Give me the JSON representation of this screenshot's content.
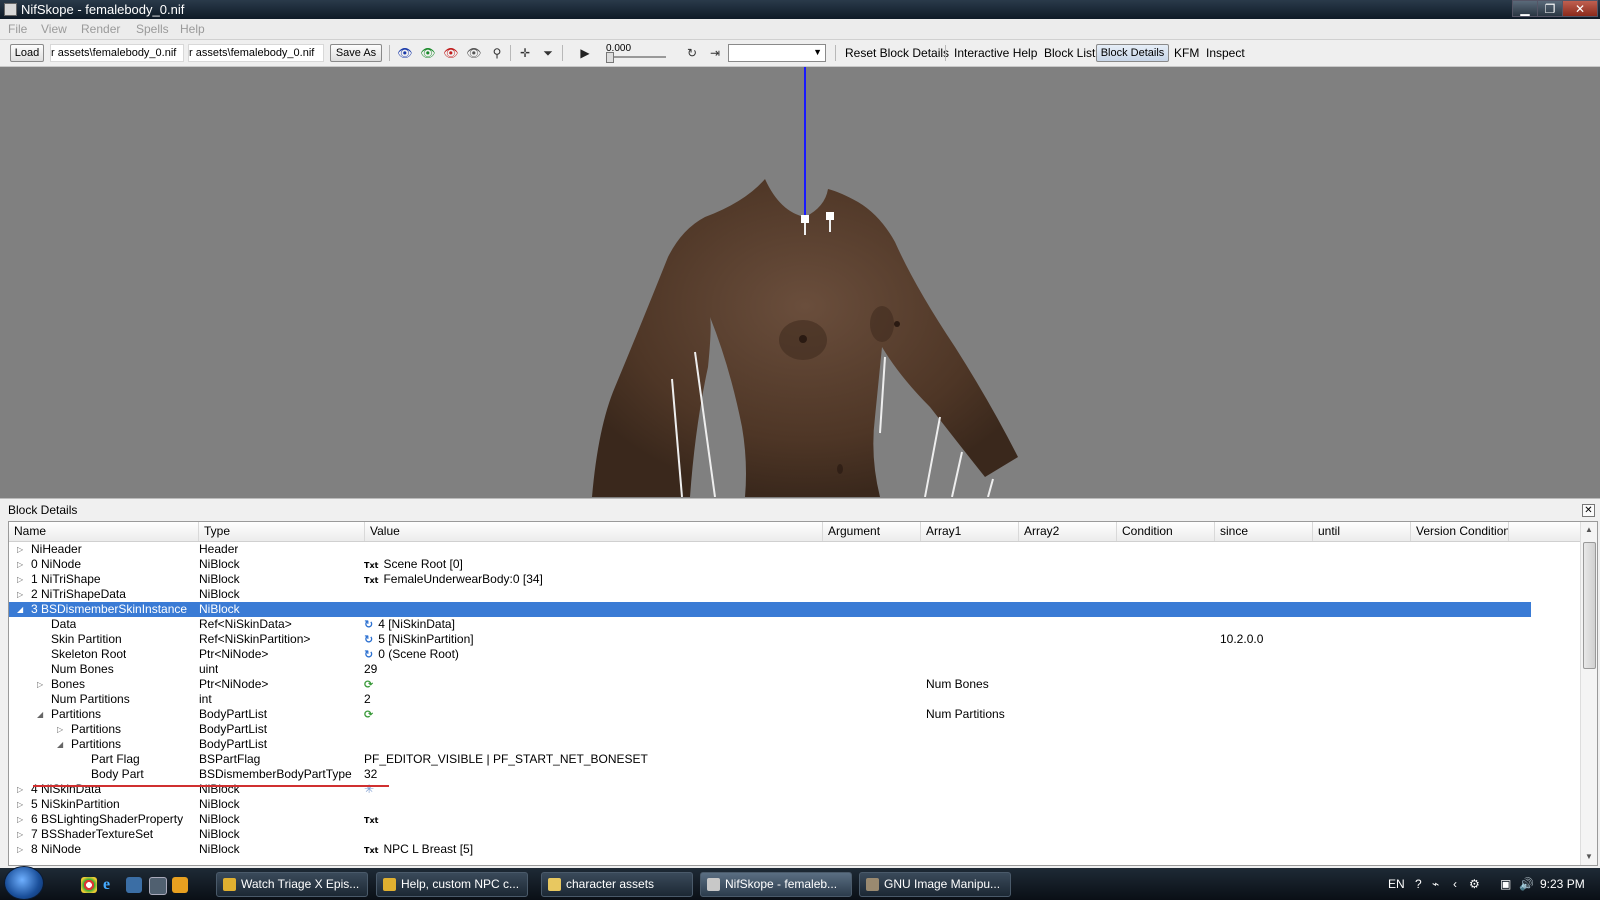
{
  "window": {
    "title": "NifSkope - femalebody_0.nif",
    "min": "▁",
    "max": "❐",
    "close": "✕"
  },
  "menu": [
    "File",
    "View",
    "Render",
    "Spells",
    "Help"
  ],
  "toolbar": {
    "load": "Load",
    "path1": "r assets\\femalebody_0.nif",
    "path2": "r assets\\femalebody_0.nif",
    "save_as": "Save As",
    "time": "0.000",
    "anim_select": "",
    "links": [
      "Reset Block Details",
      "Interactive Help",
      "Block List",
      "Block Details",
      "KFM",
      "Inspect"
    ]
  },
  "panel": {
    "title": "Block Details",
    "columns": [
      "Name",
      "Type",
      "Value",
      "Argument",
      "Array1",
      "Array2",
      "Condition",
      "since",
      "until",
      "Version Condition"
    ],
    "rows": [
      {
        "name": "NiHeader",
        "type": "Header",
        "value": "",
        "icon": "",
        "array1": "",
        "since": "",
        "level": 0,
        "exp": "closed",
        "selected": false
      },
      {
        "name": "0 NiNode",
        "type": "NiBlock",
        "value": "Scene Root [0]",
        "icon": "Txt",
        "array1": "",
        "since": "",
        "level": 0,
        "exp": "closed",
        "selected": false
      },
      {
        "name": "1 NiTriShape",
        "type": "NiBlock",
        "value": "FemaleUnderwearBody:0 [34]",
        "icon": "Txt",
        "array1": "",
        "since": "",
        "level": 0,
        "exp": "closed",
        "selected": false
      },
      {
        "name": "2 NiTriShapeData",
        "type": "NiBlock",
        "value": "",
        "icon": "",
        "array1": "",
        "since": "",
        "level": 0,
        "exp": "closed",
        "selected": false
      },
      {
        "name": "3 BSDismemberSkinInstance",
        "type": "NiBlock",
        "value": "",
        "icon": "",
        "array1": "",
        "since": "",
        "level": 0,
        "exp": "open",
        "selected": true
      },
      {
        "name": "Data",
        "type": "Ref<NiSkinData>",
        "value": "4 [NiSkinData]",
        "icon": "ref",
        "array1": "",
        "since": "",
        "level": 1,
        "exp": "",
        "selected": false
      },
      {
        "name": "Skin Partition",
        "type": "Ref<NiSkinPartition>",
        "value": "5 [NiSkinPartition]",
        "icon": "ref",
        "array1": "",
        "since": "10.2.0.0",
        "level": 1,
        "exp": "",
        "selected": false
      },
      {
        "name": "Skeleton Root",
        "type": "Ptr<NiNode>",
        "value": "0 (Scene Root)",
        "icon": "ref",
        "array1": "",
        "since": "",
        "level": 1,
        "exp": "",
        "selected": false
      },
      {
        "name": "Num Bones",
        "type": "uint",
        "value": "29",
        "icon": "",
        "array1": "",
        "since": "",
        "level": 1,
        "exp": "",
        "selected": false
      },
      {
        "name": "Bones",
        "type": "Ptr<NiNode>",
        "value": "",
        "icon": "arr",
        "array1": "Num Bones",
        "since": "",
        "level": 1,
        "exp": "closed",
        "selected": false
      },
      {
        "name": "Num Partitions",
        "type": "int",
        "value": "2",
        "icon": "",
        "array1": "",
        "since": "",
        "level": 1,
        "exp": "",
        "selected": false
      },
      {
        "name": "Partitions",
        "type": "BodyPartList",
        "value": "",
        "icon": "arr",
        "array1": "Num Partitions",
        "since": "",
        "level": 1,
        "exp": "open",
        "selected": false
      },
      {
        "name": "Partitions",
        "type": "BodyPartList",
        "value": "",
        "icon": "",
        "array1": "",
        "since": "",
        "level": 2,
        "exp": "closed",
        "selected": false
      },
      {
        "name": "Partitions",
        "type": "BodyPartList",
        "value": "",
        "icon": "",
        "array1": "",
        "since": "",
        "level": 2,
        "exp": "open",
        "selected": false
      },
      {
        "name": "Part Flag",
        "type": "BSPartFlag",
        "value": "PF_EDITOR_VISIBLE | PF_START_NET_BONESET",
        "icon": "",
        "array1": "",
        "since": "",
        "level": 3,
        "exp": "",
        "selected": false
      },
      {
        "name": "Body Part",
        "type": "BSDismemberBodyPartType",
        "value": "32",
        "icon": "",
        "array1": "",
        "since": "",
        "level": 3,
        "exp": "",
        "selected": false
      },
      {
        "name": "4 NiSkinData",
        "type": "NiBlock",
        "value": "",
        "icon": "star",
        "array1": "",
        "since": "",
        "level": 0,
        "exp": "closed",
        "selected": false
      },
      {
        "name": "5 NiSkinPartition",
        "type": "NiBlock",
        "value": "",
        "icon": "",
        "array1": "",
        "since": "",
        "level": 0,
        "exp": "closed",
        "selected": false
      },
      {
        "name": "6 BSLightingShaderProperty",
        "type": "NiBlock",
        "value": "",
        "icon": "Txt",
        "array1": "",
        "since": "",
        "level": 0,
        "exp": "closed",
        "selected": false
      },
      {
        "name": "7 BSShaderTextureSet",
        "type": "NiBlock",
        "value": "",
        "icon": "",
        "array1": "",
        "since": "",
        "level": 0,
        "exp": "closed",
        "selected": false
      },
      {
        "name": "8 NiNode",
        "type": "NiBlock",
        "value": "NPC L Breast [5]",
        "icon": "Txt",
        "array1": "",
        "since": "",
        "level": 0,
        "exp": "closed",
        "selected": false
      }
    ]
  },
  "taskbar": {
    "tasks": [
      {
        "label": "Watch Triage X Epis...",
        "icon_color": "#e0b030",
        "active": false
      },
      {
        "label": "Help, custom NPC c...",
        "icon_color": "#e0b030",
        "active": false
      },
      {
        "label": "character assets",
        "icon_color": "#e8c860",
        "active": false
      },
      {
        "label": "NifSkope - femaleb...",
        "icon_color": "#c8c8c8",
        "active": true
      },
      {
        "label": "GNU Image Manipu...",
        "icon_color": "#9a8a70",
        "active": false
      }
    ],
    "lang": "EN",
    "clock": "9:23 PM"
  },
  "colors": {
    "selection": "#3a7bd5",
    "skin": "#5a4030",
    "bone_line": "#0000ff",
    "annotation": "#d03030"
  }
}
